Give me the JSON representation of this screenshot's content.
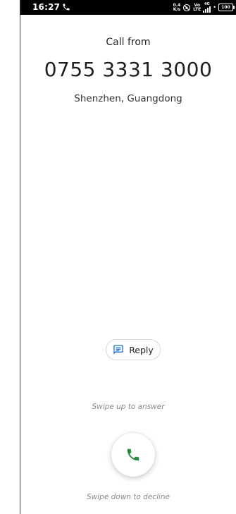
{
  "status_bar": {
    "time": "16:27",
    "net_speed_value": "0.4",
    "net_speed_unit": "K/s",
    "volte_label": "Vo",
    "lte_label": "LTE",
    "network_gen": "4G",
    "battery_level": "100",
    "icons": [
      "call-in-progress-icon",
      "mute-icon",
      "signal-icon",
      "battery-icon"
    ]
  },
  "call": {
    "header": "Call from",
    "number": "0755 3331 3000",
    "location": "Shenzhen, Guangdong"
  },
  "actions": {
    "reply_label": "Reply",
    "swipe_up_hint": "Swipe up to answer",
    "swipe_down_hint": "Swipe down to decline"
  },
  "colors": {
    "accent_green": "#1e8e3e",
    "reply_icon_blue": "#1a73e8",
    "status_bar_bg": "#000000"
  }
}
